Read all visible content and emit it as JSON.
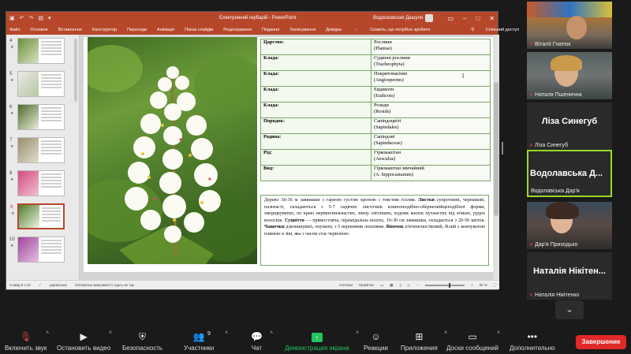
{
  "ppt": {
    "qa_icons": [
      "save-icon",
      "undo-icon",
      "redo-icon",
      "present-icon"
    ],
    "title": "Електронний гербарій - PowerPoint",
    "user": "Водолаовская Дашуля",
    "menu": [
      "Файл",
      "Основне",
      "Вставлення",
      "Конструктор",
      "Переходи",
      "Анімація",
      "Показ слайдів",
      "Рецензування",
      "Подання",
      "Записування",
      "Довідка"
    ],
    "tell_me": "Скажіть, що потрібно зробити",
    "share": "Спільний доступ",
    "thumbs": [
      {
        "num": "4",
        "star": "★"
      },
      {
        "num": "5",
        "star": "★"
      },
      {
        "num": "6",
        "star": "★"
      },
      {
        "num": "7",
        "star": "★"
      },
      {
        "num": "8",
        "star": "★"
      },
      {
        "num": "9",
        "star": "★"
      },
      {
        "num": "10",
        "star": "★"
      }
    ],
    "slide": {
      "taxonomy": [
        {
          "k": "Царство:",
          "v1": "Рослини",
          "v2": "(Plantae)"
        },
        {
          "k": "Клада:",
          "v1": "Судинні рослини",
          "v2": "(Tracheophyta)"
        },
        {
          "k": "Клада:",
          "v1": "Покритонасінні",
          "v2": "(Angiosperms)"
        },
        {
          "k": "Клада:",
          "v1": "Евдикоти",
          "v2": "(Eudicots)"
        },
        {
          "k": "Клада:",
          "v1": "Розиди",
          "v2": "(Rosids)"
        },
        {
          "k": "Порядок:",
          "v1": "Сапіндоцвіті",
          "v2": "(Sapindales)"
        },
        {
          "k": "Родина:",
          "v1": "Сапіндові",
          "v2": "(Sapindaceae)"
        },
        {
          "k": "Рід:",
          "v1": "Гіркокаштан",
          "v2": "(Aesculus)"
        },
        {
          "k": "Вид:",
          "v1": "Гіркокаштан звичайний",
          "v2": "(A. hippocastanum)"
        }
      ],
      "desc": {
        "p1": "Дерево 30-36 м заввишки з гарною густою кроною і товстим гіллям. ",
        "b1": "Листки",
        "p2": " супротивні, черешкові, пальчасті, складаються з 5-7 сидячих листочків клинопподібно-обернеовійцеподібної форми, зморщкуватих, по краю нерівнопильчастих, знизу світліших, вздовж жилок пухнастих від м'яких, рудих волосків. ",
        "b2": "Суцвіття",
        "p3": " — прямостояча, пірамідальна волоть, 10-30 см заввишки, складається з 20-50 квіток. ",
        "b3": "Чашечки",
        "p4": " дзвоникуваті, опушені, з 5 нерівними лопатями. ",
        "b4": "Віночок",
        "p5": " п'ятипелюстковий, білий з жовтуватою плямою в зіві, яка з часом стає червоною."
      }
    },
    "status": {
      "slide_num": "Слайд 9 з 42",
      "lang": "українська",
      "accessibility": "Спеціальні можливості: щось не так",
      "notes": "Нотатки",
      "comments": "Примітки",
      "zoom": "82 %"
    }
  },
  "participants": [
    {
      "name": "Віталії Гнатюк",
      "muted": true
    },
    {
      "name": "Наталя Пшенична",
      "muted": true
    },
    {
      "name": "Ліза Синегуб",
      "label": "Ліза Синегуб",
      "muted": true
    },
    {
      "name": "Водолавська Дар'я",
      "label": "Водолавська Д...",
      "muted": false,
      "active": true
    },
    {
      "name": "Дар'я Приходько",
      "muted": true
    },
    {
      "name": "Наталія Нікітенко",
      "label": "Наталія Нікітен...",
      "muted": true
    }
  ],
  "toolbar": {
    "mute": "Включить звук",
    "video": "Остановить видео",
    "security": "Безопасность",
    "participants": "Участники",
    "participants_count": "9",
    "chat": "Чат",
    "share": "Демонстрация экрана",
    "reactions": "Реакции",
    "apps": "Приложения",
    "whiteboard": "Доски сообщений",
    "more": "Дополнительно",
    "end": "Завершение"
  },
  "colors": {
    "ppt_accent": "#b7472a",
    "table_border": "#7aa66a",
    "share_green": "#22c55e",
    "end_red": "#e02828",
    "active_speaker": "#9ad82a"
  }
}
